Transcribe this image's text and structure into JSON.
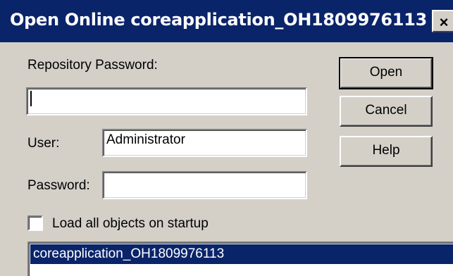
{
  "window": {
    "title": "Open Online coreapplication_OH1809976113",
    "close_label": "×"
  },
  "form": {
    "repository_password_label": "Repository Password:",
    "repository_password_value": "",
    "user_label": "User:",
    "user_value": "Administrator",
    "password_label": "Password:",
    "password_value": "",
    "load_all_label": "Load all objects on startup",
    "load_all_checked": false
  },
  "buttons": {
    "open": "Open",
    "cancel": "Cancel",
    "help": "Help"
  },
  "list": {
    "items": [
      "coreapplication_OH1809976113"
    ],
    "selected_index": 0
  },
  "colors": {
    "titlebar": "#0a246a",
    "face": "#d4d0c8",
    "selection": "#0a246a"
  }
}
